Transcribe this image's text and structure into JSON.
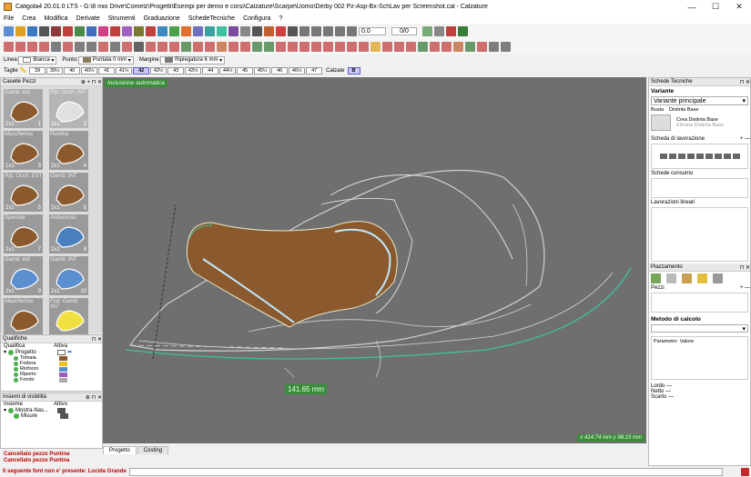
{
  "window": {
    "title": "Caligola4 20.01.0 LTS - G:\\8 mio Drive\\Comelz\\Progetti\\Esempi per demo e corsi\\Calzature\\Scarpe\\Uomo\\Derby 002 Pz-Asp-Bx-SchLav per Screenshot.cal - Calzature",
    "min": "—",
    "max": "☐",
    "close": "✕"
  },
  "menu": [
    "File",
    "Crea",
    "Modifica",
    "Derivate",
    "Strumenti",
    "Graduazione",
    "SchedeTecniche",
    "Configura",
    "?"
  ],
  "toolbar": {
    "zoom_value": "0.0",
    "counter": "0/0"
  },
  "options": {
    "linea_label": "Linea:",
    "linea_value": "Bianca",
    "linea_color": "#ffffff",
    "punto_label": "Punto:",
    "punto_value": "Puntata 0 mm",
    "margine_label": "Margine:",
    "margine_value": "Ripiegatura 6 mm"
  },
  "sizes": {
    "label": "Taglie",
    "values": [
      "39",
      "39½",
      "40",
      "40½",
      "41",
      "41½",
      "42",
      "42½",
      "43",
      "43½",
      "44",
      "44½",
      "45",
      "45½",
      "46",
      "46½",
      "47"
    ],
    "selected": "42",
    "calzate_label": "Calzate",
    "calzate_value": "B"
  },
  "pieces_panel": {
    "title": "Caselle Pezzi",
    "pieces": [
      {
        "label": "Gamb. est",
        "count": "2x1",
        "num": "1",
        "color": "#8a5a2e",
        "bg": "#a8a8a8"
      },
      {
        "label": "Rip. Occh. INT",
        "count": "2x1",
        "num": "2",
        "color": "#e0e0e0",
        "bg": "#b5b5b5"
      },
      {
        "label": "Mascherina",
        "count": "1x1",
        "num": "3",
        "color": "#8a5a2e",
        "bg": "#9a9a9a"
      },
      {
        "label": "Puntina",
        "count": "2x1",
        "num": "4",
        "color": "#8a5a2e",
        "bg": "#9a9a9a"
      },
      {
        "label": "Rip. Occh. EST",
        "count": "2x1",
        "num": "5",
        "color": "#8a5a2e",
        "bg": "#9a9a9a"
      },
      {
        "label": "Gamb. INT",
        "count": "2x1",
        "num": "6",
        "color": "#8a5a2e",
        "bg": "#9a9a9a"
      },
      {
        "label": "Sperone",
        "count": "2x1",
        "num": "7",
        "color": "#8a5a2e",
        "bg": "#9a9a9a"
      },
      {
        "label": "Antiscivolo",
        "count": "2x1",
        "num": "8",
        "color": "#4a7fbd",
        "bg": "#9a9a9a"
      },
      {
        "label": "Gamb. est",
        "count": "2x1",
        "num": "9",
        "color": "#5b8fd0",
        "bg": "#9a9a9a"
      },
      {
        "label": "Gamb. INT",
        "count": "2x1",
        "num": "10",
        "color": "#5b8fd0",
        "bg": "#9a9a9a"
      },
      {
        "label": "Mascherina",
        "count": "",
        "num": "",
        "color": "#8a5a2e",
        "bg": "#9a9a9a"
      },
      {
        "label": "Fod. Gamb. INT",
        "count": "",
        "num": "",
        "color": "#f0e040",
        "bg": "#9a9a9a"
      }
    ]
  },
  "qualifiche": {
    "title": "Qualifiche",
    "col1": "Qualifica",
    "col2": "Attiva",
    "root": "Progetto",
    "items": [
      {
        "name": "Tomaia",
        "color": "#8a5a2e"
      },
      {
        "name": "Fodera",
        "color": "#e8c020"
      },
      {
        "name": "Rinforzo",
        "color": "#5b8fd0"
      },
      {
        "name": "Riporto",
        "color": "#9a5ac0"
      },
      {
        "name": "Fondo",
        "color": "#aaaaaa"
      }
    ]
  },
  "visibilita": {
    "title": "Insiemi di visibilità",
    "col1": "Insieme",
    "col2": "Attivo",
    "root": "Mostra-Nas...",
    "child": "Misure"
  },
  "canvas": {
    "mode_label": "Inclusione automatica",
    "measure": "141.65 mm",
    "coords": "x 414.74 mm  y 98.15 mm",
    "bg": "#6f6f6f",
    "piece_fill": "#8a5a2e",
    "seam_color": "#3fbfa0"
  },
  "tabs": [
    "Progetto",
    "Costing"
  ],
  "messages": [
    "Cancellato pezzo Puntina",
    "Cancellato pezzo Puntina"
  ],
  "bottom": {
    "error": "Il seguente font non e' presente: Lucida Grande"
  },
  "right": {
    "schede_title": "Schede Tecniche",
    "variante_label": "Variante",
    "variante_value": "Variante principale",
    "busta": "Busta",
    "distinta_base": "Distinta Base",
    "crea": "Crea Distinta Base",
    "elimina": "Elimina Distinta Base",
    "scheda_lav": "Scheda di lavorazione",
    "schede_consumo": "Schede consumo",
    "lav_lineari": "Lavorazioni lineari",
    "piazz_title": "Piazzamento",
    "pezzi": "Pezzi",
    "metodo": "Metodo di calcolo",
    "parametro": "Parametro",
    "valore": "Valore",
    "lordo": "Lordo",
    "netto": "Netto",
    "scarto": "Scarto",
    "dash": "—"
  }
}
